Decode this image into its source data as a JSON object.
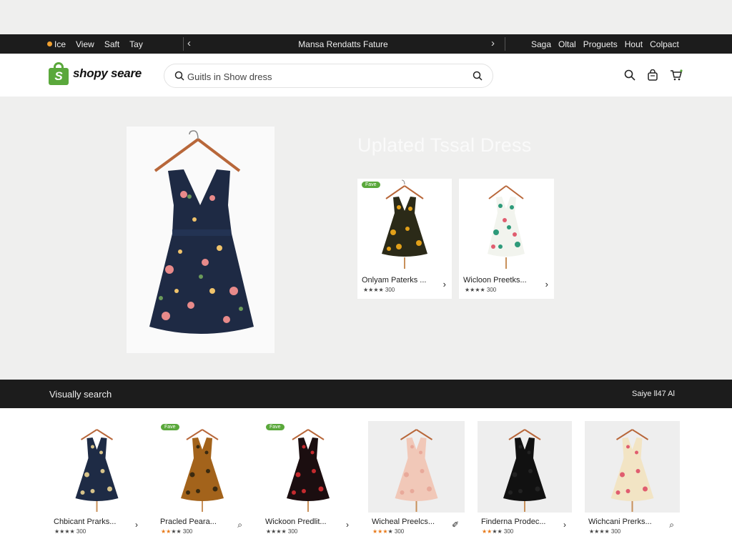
{
  "topbar": {
    "left_items": [
      "Ice",
      "View",
      "Saft",
      "Tay"
    ],
    "center_title": "Mansa Rendatts Fature",
    "right_items": [
      "Saga",
      "Oltal",
      "Proguets",
      "Hout",
      "Colpact"
    ]
  },
  "header": {
    "brand": "shopy seare",
    "search_placeholder": "Guitls in Show dress"
  },
  "hero": {
    "title": "Uplated Tssal Dress",
    "cards": [
      {
        "name": "Onlyam Paterks ...",
        "rating": "★★★★ 300",
        "badge": "Fave",
        "dress_color": "#2b2a18",
        "print": "#e2a019"
      },
      {
        "name": "Wicloon Preetks...",
        "rating": "★★★★ 300",
        "badge": "",
        "dress_color": "#f2f4ee",
        "print": "#2e9a7a"
      }
    ]
  },
  "visual_search": {
    "title": "Visually search",
    "right_label": "Saiye ll47 Al",
    "products": [
      {
        "name": "Chbicant Prarks...",
        "rating": "★★★★ 300",
        "orange_stars": 0,
        "badge": "",
        "arrow": "›",
        "dress_color": "#1e2b45",
        "print": "#d7c38a",
        "bg": "#ffffff"
      },
      {
        "name": "Pracled Peara...",
        "rating": "★★★★ 300",
        "orange_stars": 2,
        "badge": "Fave",
        "arrow": "⌕",
        "dress_color": "#a3631b",
        "print": "#3a2a10",
        "bg": "#ffffff"
      },
      {
        "name": "Wickoon Predlit...",
        "rating": "★★★★ 300",
        "orange_stars": 0,
        "badge": "Fave",
        "arrow": "›",
        "dress_color": "#1b0e10",
        "print": "#c42a2e",
        "bg": "#ffffff"
      },
      {
        "name": "Wicheal Preelcs...",
        "rating": "★★★★ 300",
        "orange_stars": 3,
        "badge": "",
        "arrow": "✐",
        "dress_color": "#f1c8b8",
        "print": "#e8a99a",
        "bg": "#eeeeee"
      },
      {
        "name": "Finderna Prodec...",
        "rating": "★★★★ 300",
        "orange_stars": 2,
        "badge": "",
        "arrow": "›",
        "dress_color": "#111111",
        "print": "#222222",
        "bg": "#eeeeee"
      },
      {
        "name": "Wichcani Prerks...",
        "rating": "★★★★ 300",
        "orange_stars": 0,
        "badge": "",
        "arrow": "⌕",
        "dress_color": "#f2e4c4",
        "print": "#e05d6f",
        "bg": "#eeeeee"
      }
    ]
  }
}
